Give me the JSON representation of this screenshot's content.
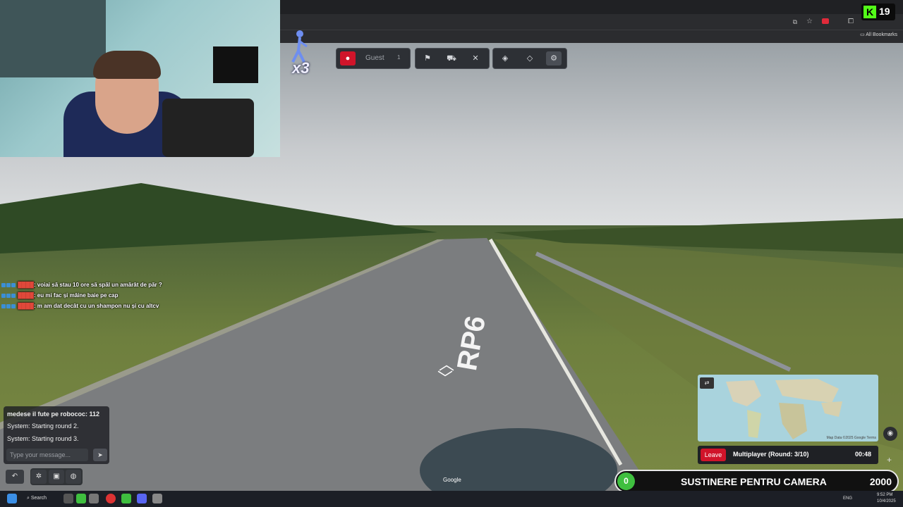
{
  "browser": {
    "bookmarks_label": "All Bookmarks"
  },
  "kick": {
    "viewers": "19"
  },
  "toolbar": {
    "guest_label": "Guest",
    "guest_count": "1"
  },
  "multiplier": "x3",
  "overlay_chat": [
    {
      "user": "████",
      "text": ": voiai să stau 10 ore să spăl un amărât de păr ?"
    },
    {
      "user": "████",
      "text": ": eu mi fac și mâine baie pe cap"
    },
    {
      "user": "████",
      "text": ": m am dat decât cu un shampon nu și cu altcv"
    }
  ],
  "game_chat": {
    "messages": [
      "medese il fute pe robococ: 112",
      "System: Starting round 2.",
      "System: Starting round 3."
    ],
    "input_placeholder": "Type your message..."
  },
  "road_label": "RP6",
  "google_label": "Google",
  "minimap": {
    "attribution": "Map Data ©2025 Google",
    "terms": "Terms"
  },
  "round_bar": {
    "leave_label": "Leave",
    "round_text": "Multiplayer (Round: 3/10)",
    "timer": "00:48"
  },
  "goal": {
    "current": "0",
    "title": "SUSTINERE PENTRU CAMERA",
    "target": "2000"
  },
  "taskbar": {
    "search_label": "Search",
    "lang": "ENG",
    "time": "9:52 PM",
    "date": "10/4/2025"
  }
}
